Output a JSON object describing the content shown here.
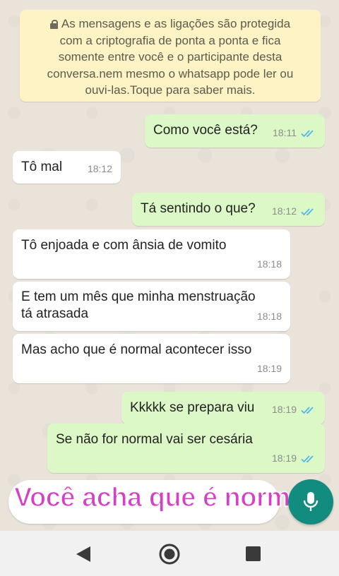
{
  "encryption_notice": {
    "lines": [
      "As mensagens e as ligações são protegida",
      "com a criptografia de ponta a ponta e fica",
      "somente entre você e o participante desta",
      "conversa.nem mesmo o whatsapp pode ler ou",
      "ouvi-las.Toque para saber mais."
    ]
  },
  "messages": [
    {
      "direction": "outgoing",
      "lines": [
        "Como você está?"
      ],
      "time": "18:11",
      "status": "read"
    },
    {
      "direction": "incoming",
      "lines": [
        "Tô mal"
      ],
      "time": "18:12"
    },
    {
      "direction": "outgoing",
      "lines": [
        "Tá sentindo o que?"
      ],
      "time": "18:12",
      "status": "read"
    },
    {
      "direction": "incoming",
      "lines": [
        "Tô enjoada e com ânsia de vomito"
      ],
      "time": "18:18"
    },
    {
      "direction": "incoming",
      "lines": [
        "E tem um mês que minha menstruação",
        "tá atrasada"
      ],
      "time": "18:18"
    },
    {
      "direction": "incoming",
      "lines": [
        "Mas acho que é normal acontecer isso"
      ],
      "time": "18:19"
    },
    {
      "direction": "outgoing",
      "lines": [
        "Kkkkk se prepara viu"
      ],
      "time": "18:19",
      "status": "read"
    },
    {
      "direction": "outgoing",
      "lines": [
        "Se não for normal vai ser cesária"
      ],
      "time": "18:19",
      "status": "read"
    }
  ],
  "composer": {
    "placeholder": "",
    "caption_overlay": "Você acha que é normal?"
  },
  "icons": {
    "lock": "lock-icon",
    "read_ticks": "double-check-icon",
    "mic": "mic-icon",
    "nav_back": "triangle-back-icon",
    "nav_home": "circle-home-icon",
    "nav_recent": "square-recent-icon"
  },
  "colors": {
    "outgoing_bubble": "#dcf8c6",
    "incoming_bubble": "#ffffff",
    "notice_bg": "#fdf3c4",
    "read_ticks": "#4fb6ec",
    "mic_button": "#128c7e",
    "caption": "#d63fc6"
  }
}
